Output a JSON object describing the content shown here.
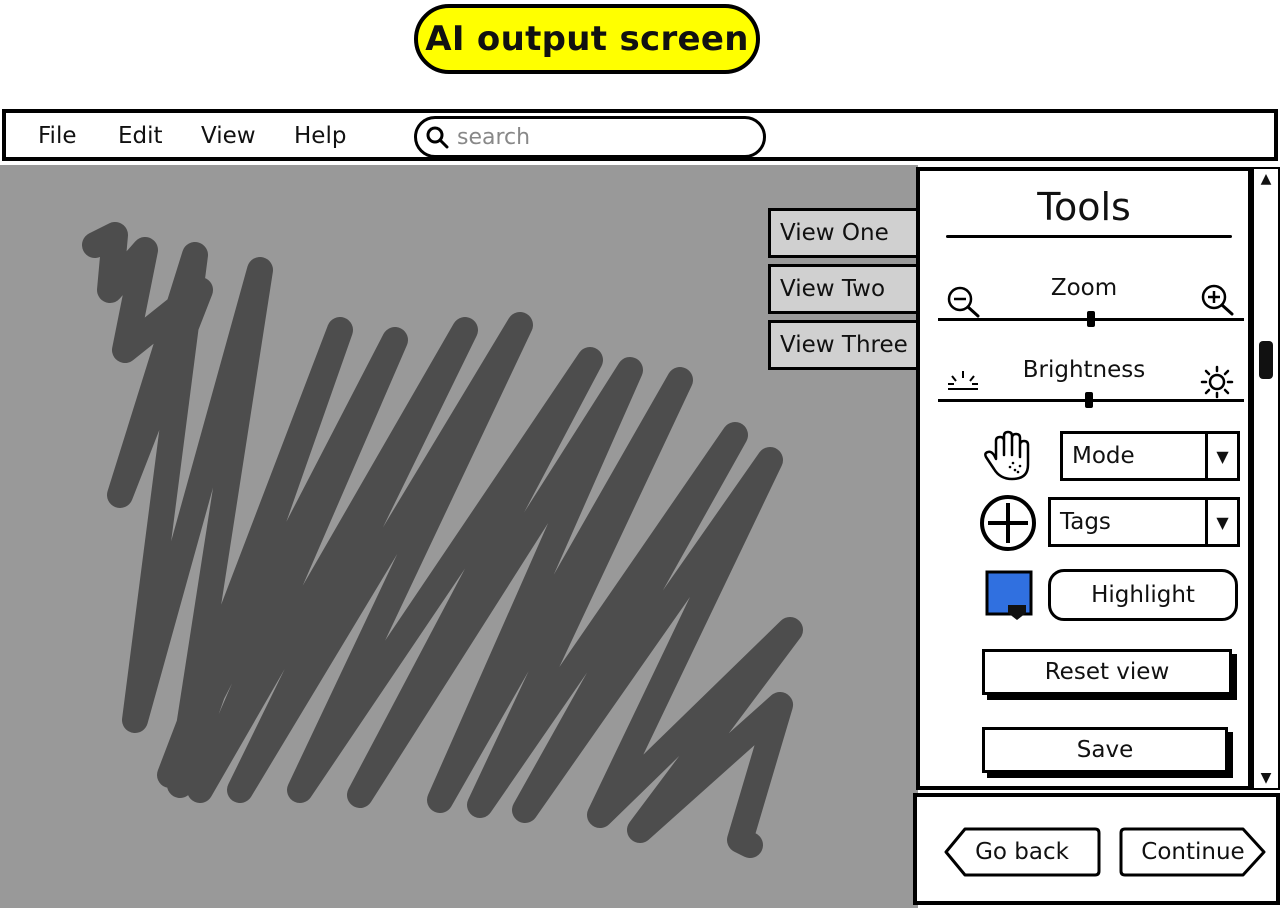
{
  "title": "AI output screen",
  "menu": [
    "File",
    "Edit",
    "View",
    "Help"
  ],
  "search": {
    "placeholder": "search"
  },
  "views": [
    "View One",
    "View Two",
    "View Three"
  ],
  "tools": {
    "title": "Tools",
    "zoom_label": "Zoom",
    "zoom_value": 0.5,
    "brightness_label": "Brightness",
    "brightness_value": 0.5,
    "mode_label": "Mode",
    "tags_label": "Tags",
    "highlight_label": "Highlight",
    "highlight_color": "#3070e0",
    "reset_label": "Reset view",
    "save_label": "Save"
  },
  "nav": {
    "back_label": "Go back",
    "continue_label": "Continue"
  },
  "colors": {
    "title_bg": "#ffff00",
    "canvas_bg": "#999999",
    "scribble": "#4d4d4d",
    "tab_bg": "#d0d0d0"
  },
  "icons": [
    "search-icon",
    "zoom-out-icon",
    "zoom-in-icon",
    "brightness-low-icon",
    "brightness-high-icon",
    "hand-icon",
    "plus-circle-icon",
    "color-picker-icon",
    "chevron-down-icon"
  ]
}
